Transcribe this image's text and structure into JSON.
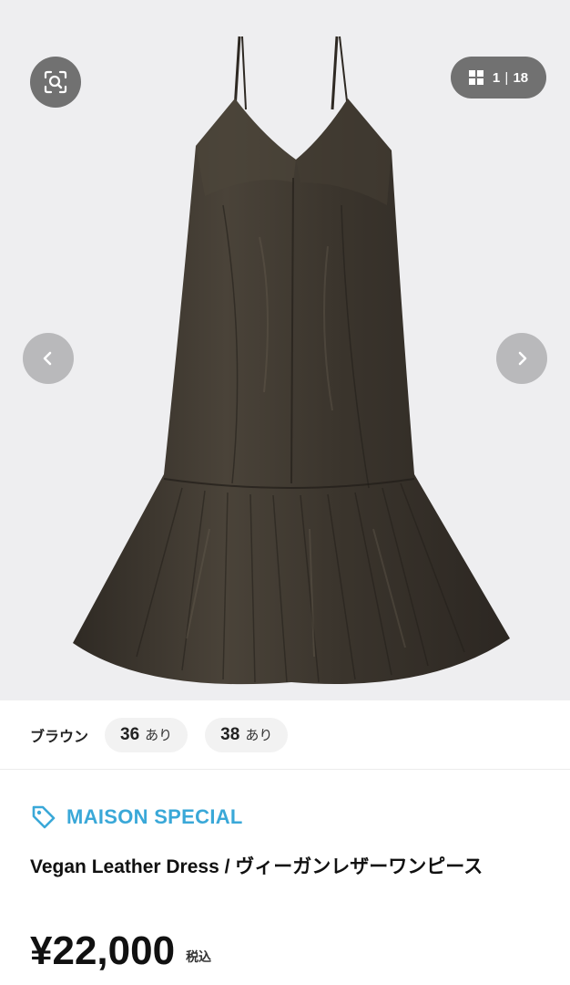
{
  "gallery": {
    "counter_current": "1",
    "counter_sep": "|",
    "counter_total": "18",
    "background": "#eeeef0",
    "dress_color": "#3d372f"
  },
  "variants": {
    "color_label": "ブラウン",
    "options": [
      {
        "size": "36",
        "stock": "あり"
      },
      {
        "size": "38",
        "stock": "あり"
      }
    ]
  },
  "product": {
    "brand": "MAISON SPECIAL",
    "brand_color": "#3aa8d8",
    "title": "Vegan Leather Dress / ヴィーガンレザーワンピース",
    "price": "¥22,000",
    "tax_label": "税込"
  },
  "icons": {
    "lens": "image-search-icon",
    "grid": "grid-icon",
    "prev": "chevron-left-icon",
    "next": "chevron-right-icon",
    "brand_tag": "tag-icon"
  }
}
